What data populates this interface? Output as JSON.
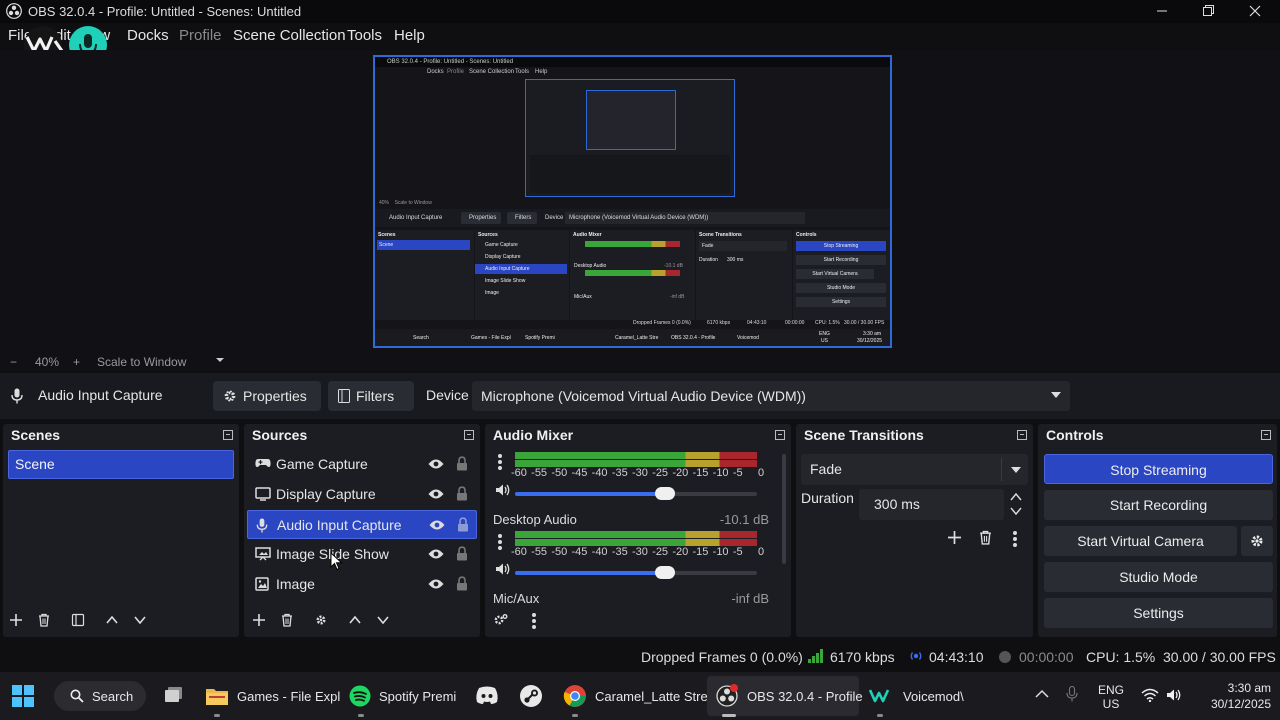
{
  "window": {
    "title": "OBS 32.0.4 - Profile: Untitled - Scenes: Untitled"
  },
  "menu": {
    "file": "File",
    "edit": "Edit",
    "view": "View",
    "docks": "Docks",
    "profile": "Profile",
    "scene_collection": "Scene Collection",
    "tools": "Tools",
    "help": "Help"
  },
  "zoom": {
    "minus": "−",
    "value": "40%",
    "plus": "+",
    "mode": "Scale to Window"
  },
  "context": {
    "source_name": "Audio Input Capture",
    "properties_label": "Properties",
    "filters_label": "Filters",
    "device_label": "Device",
    "device_value": "Microphone (Voicemod Virtual Audio Device (WDM))"
  },
  "scenes": {
    "title": "Scenes",
    "items": [
      "Scene"
    ]
  },
  "sources": {
    "title": "Sources",
    "items": [
      {
        "label": "Game Capture",
        "icon": "gamepad-icon"
      },
      {
        "label": "Display Capture",
        "icon": "monitor-icon"
      },
      {
        "label": "Audio Input Capture",
        "icon": "microphone-icon",
        "selected": true
      },
      {
        "label": "Image Slide Show",
        "icon": "slideshow-icon"
      },
      {
        "label": "Image",
        "icon": "image-icon"
      }
    ]
  },
  "mixer": {
    "title": "Audio Mixer",
    "ticks": [
      "-60",
      "-55",
      "-50",
      "-45",
      "-40",
      "-35",
      "-30",
      "-25",
      "-20",
      "-15",
      "-10",
      "-5",
      "0"
    ],
    "channels": [
      {
        "name": "",
        "db": "",
        "volume": 0.62
      },
      {
        "name": "Desktop Audio",
        "db": "-10.1 dB",
        "volume": 0.62
      },
      {
        "name": "Mic/Aux",
        "db": "-inf dB"
      }
    ]
  },
  "transitions": {
    "title": "Scene Transitions",
    "selected": "Fade",
    "duration_label": "Duration",
    "duration_value": "300 ms"
  },
  "controls": {
    "title": "Controls",
    "stop_streaming": "Stop Streaming",
    "start_recording": "Start Recording",
    "start_virtual_camera": "Start Virtual Camera",
    "studio_mode": "Studio Mode",
    "settings": "Settings"
  },
  "status": {
    "dropped_frames": "Dropped Frames 0 (0.0%)",
    "bitrate": "6170 kbps",
    "stream_time": "04:43:10",
    "record_time": "00:00:00",
    "cpu": "CPU: 1.5%",
    "fps": "30.00 / 30.00 FPS"
  },
  "taskbar": {
    "search": "Search",
    "games": "Games - File Expl",
    "spotify": "Spotify Premi",
    "chrome": "Caramel_Latte Stre",
    "obs": "OBS 32.0.4 - Profile",
    "voicemod": "Voicemod\\",
    "lang1": "ENG",
    "lang2": "US",
    "time": "3:30 am",
    "date": "30/12/2025"
  },
  "preview": {
    "title": "OBS 32.0.4 - Profile: Untitled - Scenes: Untitled",
    "menu": [
      "Docks",
      "Profile",
      "Scene Collection",
      "Tools",
      "Help"
    ],
    "source_name": "Audio Input Capture",
    "properties_label": "Properties",
    "filters_label": "Filters",
    "device_label": "Device",
    "device_value": "Microphone (Voicemod Virtual Audio Device (WDM))",
    "zoom": "40%",
    "zoom_mode": "Scale to Window",
    "scenes_title": "Scenes",
    "scene_item": "Scene",
    "sources_title": "Sources",
    "sources": [
      "Game Capture",
      "Display Capture",
      "Audio Input Capture",
      "Image Slide Show",
      "Image"
    ],
    "mixer_title": "Audio Mixer",
    "desktop_audio": "Desktop Audio",
    "desktop_db": "-10.1 dB",
    "mic_aux": "Mic/Aux",
    "mic_db": "-inf dB",
    "transitions_title": "Scene Transitions",
    "fade": "Fade",
    "duration_label": "Duration",
    "duration_value": "300 ms",
    "controls_title": "Controls",
    "controls": [
      "Stop Streaming",
      "Start Recording",
      "Start Virtual Camera",
      "Studio Mode",
      "Settings"
    ],
    "status": [
      "Dropped Frames 0 (0.0%)",
      "6170 kbps",
      "04:43:10",
      "00:00:00",
      "CPU: 1.5%",
      "30.00 / 30.00 FPS"
    ],
    "taskbar": [
      "Search",
      "Games - File Expl",
      "Spotify Premi",
      "Caramel_Latte Stre",
      "OBS 32.0.4 - Profile",
      "Voicemod"
    ],
    "lang1": "ENG",
    "lang2": "US",
    "time": "3:30 am",
    "date": "30/12/2025"
  },
  "colors": {
    "accent": "#2a46c2",
    "meter_green": "#3aa63a",
    "meter_yellow": "#b7a22e",
    "meter_red": "#a8262e"
  }
}
